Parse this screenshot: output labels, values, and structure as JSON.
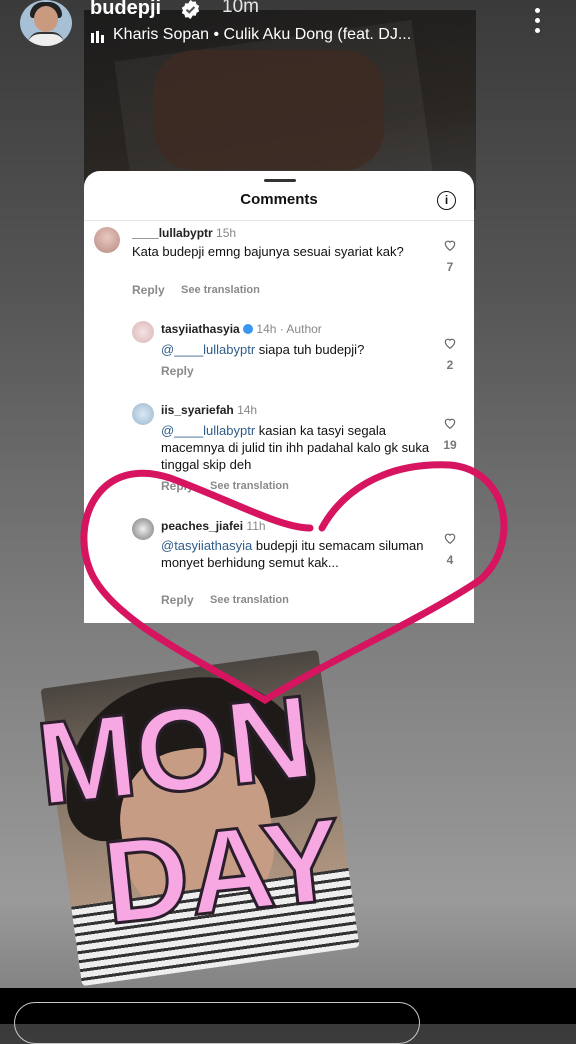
{
  "header": {
    "username": "budepji",
    "time": "10m",
    "music": "Kharis Sopan • Culik Aku Dong (feat. DJ..."
  },
  "comments_panel": {
    "title": "Comments",
    "reply_label": "Reply",
    "see_translation_label": "See translation",
    "comments": [
      {
        "user": "____lullabyptr",
        "meta": "15h",
        "text": "Kata budepji emng bajunya sesuai syariat kak?",
        "likes": "7",
        "show_see_translation": true
      },
      {
        "user": "tasyiiathasyia",
        "meta": "14h · Author",
        "mention": "@____lullabyptr",
        "text": " siapa tuh budepji?",
        "likes": "2",
        "show_see_translation": false
      },
      {
        "user": "iis_syariefah",
        "meta": "14h",
        "mention": "@____lullabyptr",
        "text": " kasian ka tasyi segala macemnya di julid tin ihh padahal kalo gk suka tinggal skip deh",
        "likes": "19",
        "show_see_translation": true
      },
      {
        "user": "peaches_jiafei",
        "meta": "11h",
        "mention": "@tasyiiathasyia",
        "text": " budepji itu semacam siluman monyet berhidung semut kak...",
        "likes": "4",
        "show_see_translation": true
      }
    ]
  },
  "sticker": {
    "line1": "MON",
    "line2": "DAY"
  },
  "colors": {
    "heart_stroke": "#d6145f",
    "sticker_fill": "#f7a8e3",
    "sticker_outline": "#2a1e2a",
    "mention": "#2f5d8a"
  },
  "icons": [
    "verified-badge-icon",
    "music-bars-icon",
    "more-options-icon",
    "info-icon",
    "heart-outline-icon"
  ]
}
